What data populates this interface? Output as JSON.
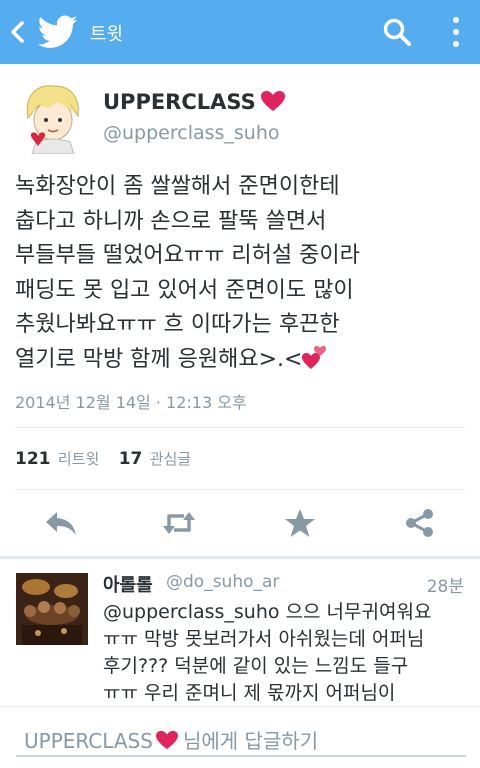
{
  "colors": {
    "brand": "#55acee",
    "heart": "#e0245e",
    "muted": "#8899a6",
    "text": "#292f33"
  },
  "topbar": {
    "title": "트윗",
    "back_icon": "chevron-left-icon",
    "logo_icon": "twitter-bird-icon",
    "search_icon": "search-icon",
    "more_icon": "overflow-menu-icon"
  },
  "tweet": {
    "author_name": "UPPERCLASS",
    "author_handle": "@upperclass_suho",
    "lines": [
      "녹화장안이 좀 쌀쌀해서 준면이한테",
      "춥다고 하니까 손으로 팔뚝 쓸면서",
      "부들부들 떨었어요ㅠㅠ 리허설 중이라",
      "패딩도 못 입고 있어서 준면이도 많이",
      "추웠나봐요ㅠㅠ 흐 이따가는 후끈한",
      "열기로 막방 함께 응원해요>.<"
    ],
    "timestamp": "2014년 12월 14일 · 12:13 오후",
    "retweet_count": "121",
    "retweet_label": "리트윗",
    "favorite_count": "17",
    "favorite_label": "관심글"
  },
  "actions": [
    "reply-icon",
    "retweet-icon",
    "favorite-star-icon",
    "share-icon"
  ],
  "reply": {
    "name": "아롤롤",
    "handle": "@do_suho_ar",
    "time": "28분",
    "lines": [
      "@upperclass_suho 으으 너무귀여워요",
      "ㅠㅠ 막방 못보러가서 아쉬웠는데 어퍼님",
      "후기??? 덕분에 같이 있는 느낌도 들구",
      "ㅠㅠ 우리 준며니 제 몫까지 어퍼님이"
    ]
  },
  "composer": {
    "recipient": "UPPERCLASS",
    "suffix": "님에게 답글하기"
  }
}
